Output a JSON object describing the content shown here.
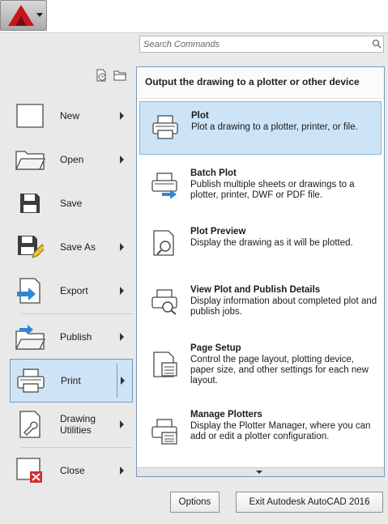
{
  "search": {
    "placeholder": "Search Commands"
  },
  "left_menu": [
    {
      "label": "New",
      "icon": "new-document-icon",
      "arrow": true
    },
    {
      "label": "Open",
      "icon": "open-folder-icon",
      "arrow": true
    },
    {
      "label": "Save",
      "icon": "save-disk-icon",
      "arrow": false
    },
    {
      "label": "Save As",
      "icon": "save-as-icon",
      "arrow": true
    },
    {
      "label": "Export",
      "icon": "export-icon",
      "arrow": true
    },
    {
      "label": "Publish",
      "icon": "publish-icon",
      "arrow": true
    },
    {
      "label": "Print",
      "icon": "printer-icon",
      "arrow": true,
      "active": true
    },
    {
      "label": "Drawing Utilities",
      "icon": "drawing-utilities-icon",
      "arrow": true
    },
    {
      "label": "Close",
      "icon": "close-document-icon",
      "arrow": true
    }
  ],
  "submenu": {
    "header": "Output the drawing to a plotter or other device",
    "items": [
      {
        "title": "Plot",
        "desc": "Plot a drawing to a plotter, printer, or file.",
        "icon": "printer-icon",
        "selected": true
      },
      {
        "title": "Batch Plot",
        "desc": "Publish multiple sheets or drawings to a plotter, printer, DWF or PDF file.",
        "icon": "batch-plot-icon"
      },
      {
        "title": "Plot Preview",
        "desc": "Display the drawing as it will be plotted.",
        "icon": "plot-preview-icon"
      },
      {
        "title": "View Plot and Publish Details",
        "desc": "Display information about completed plot and publish jobs.",
        "icon": "plot-details-icon"
      },
      {
        "title": "Page Setup",
        "desc": "Control the page layout, plotting device, paper size, and other settings for each new layout.",
        "icon": "page-setup-icon"
      },
      {
        "title": "Manage Plotters",
        "desc": "Display the Plotter Manager, where you can add or edit a plotter configuration.",
        "icon": "manage-plotters-icon"
      }
    ]
  },
  "footer": {
    "options_label": "Options",
    "exit_label": "Exit Autodesk AutoCAD 2016"
  },
  "colors": {
    "accent_red": "#c8161d",
    "selection_blue": "#cde4f7",
    "selection_border": "#87b2d9"
  }
}
